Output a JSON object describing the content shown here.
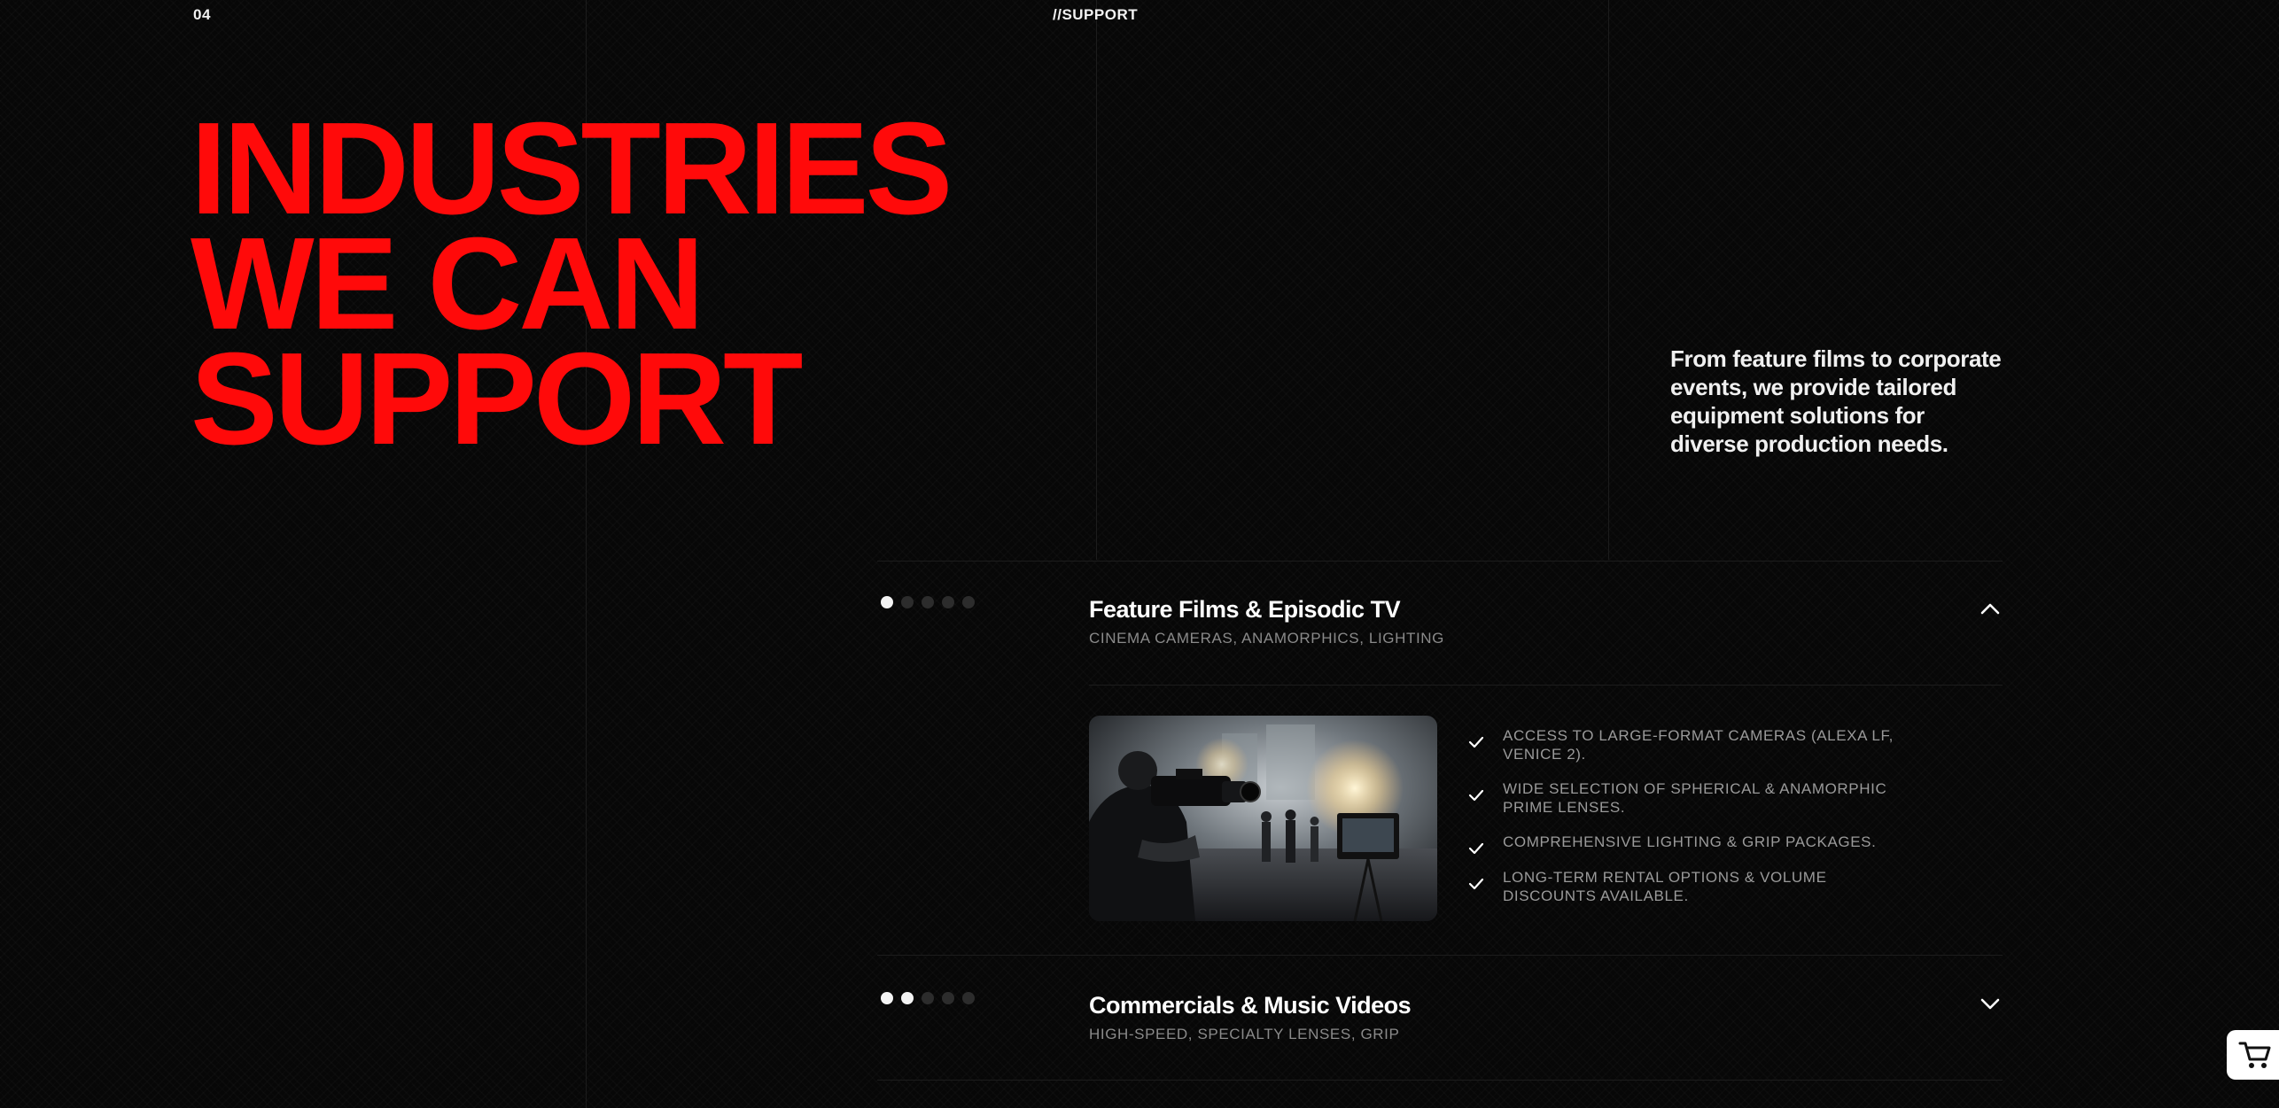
{
  "section": {
    "number": "04",
    "tag": "//SUPPORT"
  },
  "headline": {
    "line1": "INDUSTRIES",
    "line2": "WE CAN",
    "line3": "SUPPORT"
  },
  "intro": "From feature films to corporate events, we provide tailored equipment solutions for diverse production needs.",
  "colors": {
    "accent": "#ff0a0a",
    "background": "#070707",
    "muted_text": "#8a8a8a"
  },
  "industries": [
    {
      "title": "Feature Films & Episodic TV",
      "subtitle": "CINEMA CAMERAS, ANAMORPHICS, LIGHTING",
      "expanded": true,
      "dots_active": 1,
      "dots_total": 5,
      "toggle_icon": "chevron-up-icon",
      "image": "camera-operator-on-film-set",
      "features": [
        "ACCESS TO LARGE-FORMAT CAMERAS (ALEXA LF, VENICE 2).",
        "WIDE SELECTION OF SPHERICAL & ANAMORPHIC PRIME LENSES.",
        "COMPREHENSIVE LIGHTING & GRIP PACKAGES.",
        "LONG-TERM RENTAL OPTIONS & VOLUME DISCOUNTS AVAILABLE."
      ]
    },
    {
      "title": "Commercials & Music Videos",
      "subtitle": "HIGH-SPEED, SPECIALTY LENSES, GRIP",
      "expanded": false,
      "dots_active": 2,
      "dots_total": 5,
      "toggle_icon": "chevron-down-icon"
    }
  ],
  "cart": {
    "icon": "cart-icon"
  }
}
